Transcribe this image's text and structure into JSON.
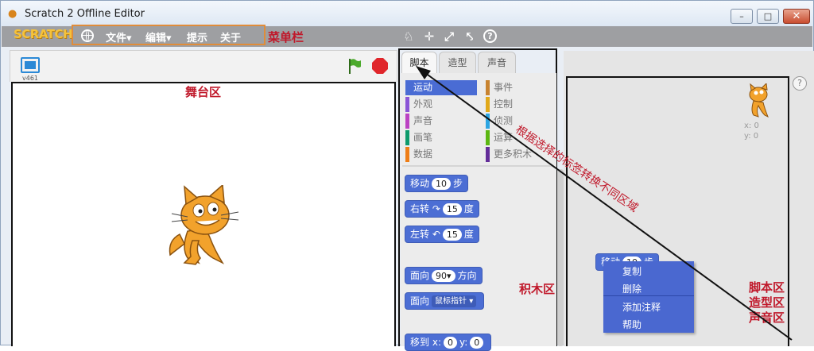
{
  "window": {
    "title": "Scratch 2 Offline Editor",
    "minimize": "–",
    "maximize": "□",
    "close": "✕"
  },
  "menubar": {
    "logo": "SCRATCH",
    "items": [
      "文件▾",
      "编辑▾",
      "提示",
      "关于"
    ],
    "annotation": "菜单栏",
    "tools": [
      "duplicate-icon",
      "delete-icon",
      "grow-icon",
      "shrink-icon",
      "help-icon"
    ],
    "tool_glyphs": [
      "♘",
      "✛",
      "⤢",
      "⤣",
      "?"
    ]
  },
  "stage": {
    "version": "v461",
    "annotation": "舞台区"
  },
  "tabs": [
    "脚本",
    "造型",
    "声音"
  ],
  "palette": {
    "categories_left": [
      {
        "label": "运动",
        "color": "#4a6cd4"
      },
      {
        "label": "外观",
        "color": "#8a55d7"
      },
      {
        "label": "声音",
        "color": "#bb42c3"
      },
      {
        "label": "画笔",
        "color": "#0e9a6c"
      },
      {
        "label": "数据",
        "color": "#ee7d16"
      }
    ],
    "categories_right": [
      {
        "label": "事件",
        "color": "#c88330"
      },
      {
        "label": "控制",
        "color": "#e1a91a"
      },
      {
        "label": "侦测",
        "color": "#2ca5e2"
      },
      {
        "label": "运算",
        "color": "#5cb712"
      },
      {
        "label": "更多积木",
        "color": "#632d99"
      }
    ],
    "annotation": "积木区",
    "blocks": {
      "move": {
        "label": "移动",
        "value": "10",
        "suffix": "步"
      },
      "turn_right": {
        "label": "右转",
        "arrow": "↷",
        "value": "15",
        "suffix": "度"
      },
      "turn_left": {
        "label": "左转",
        "arrow": "↶",
        "value": "15",
        "suffix": "度"
      },
      "point_direction": {
        "label": "面向",
        "value": "90▾",
        "suffix": "方向"
      },
      "point_towards": {
        "label": "面向",
        "value": "鼠标指针 ▾"
      },
      "goto_xy": {
        "label": "移到",
        "xlabel": "x:",
        "xvalue": "0",
        "ylabel": "y:",
        "yvalue": "0"
      }
    }
  },
  "scripts": {
    "help": "?",
    "x_readout": "x: 0",
    "y_readout": "y: 0",
    "dragged_block": {
      "label": "移动",
      "value": "10",
      "suffix": "步"
    },
    "context_menu": [
      "复制",
      "删除",
      "添加注释",
      "帮助"
    ],
    "annotations": [
      "脚本区",
      "造型区",
      "声音区"
    ]
  },
  "arrow_note": "根据选择的标签转换不同区域",
  "colors": {
    "annotation": "#c0182a",
    "motion_block": "#4c6ed4",
    "menu_outline": "#e08c3a"
  }
}
